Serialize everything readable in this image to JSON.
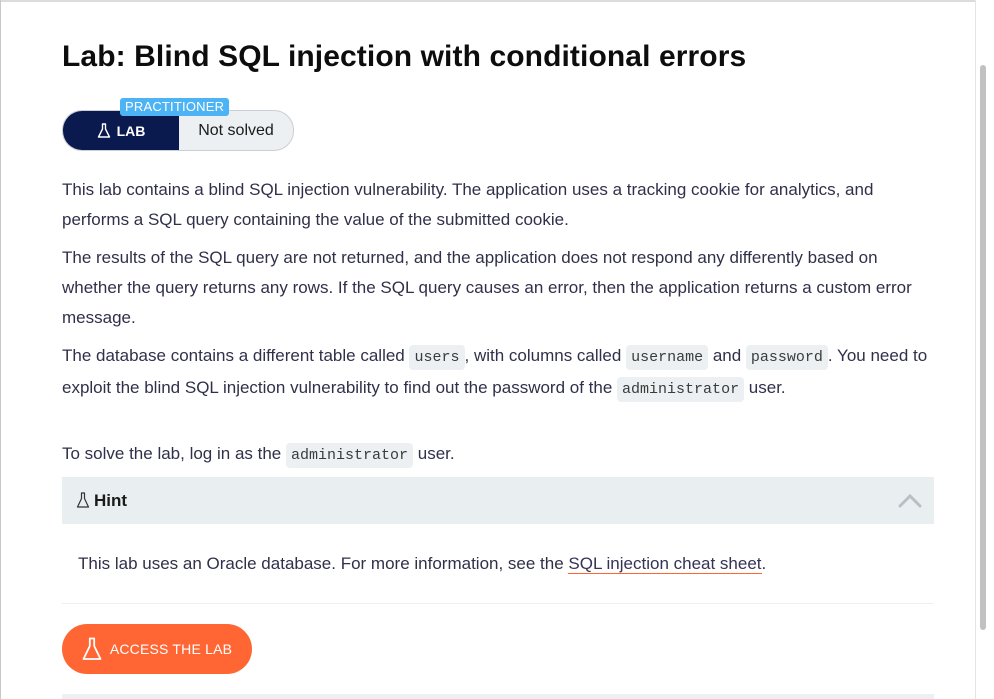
{
  "title": "Lab: Blind SQL injection with conditional errors",
  "badge": {
    "level": "PRACTITIONER",
    "lab_label": "LAB",
    "status": "Not solved"
  },
  "description": {
    "p1": "This lab contains a blind SQL injection vulnerability. The application uses a tracking cookie for analytics, and performs a SQL query containing the value of the submitted cookie.",
    "p2": "The results of the SQL query are not returned, and the application does not respond any differently based on whether the query returns any rows. If the SQL query causes an error, then the application returns a custom error message.",
    "p3": {
      "t1": "The database contains a different table called ",
      "code_users": "users",
      "t2": ", with columns called ",
      "code_username": "username",
      "t3": " and ",
      "code_password": "password",
      "t4": ". You need to exploit the blind SQL injection vulnerability to find out the password of the ",
      "code_admin": "administrator",
      "t5": " user."
    },
    "p4": {
      "t1": "To solve the lab, log in as the ",
      "code_admin": "administrator",
      "t2": " user."
    }
  },
  "hint": {
    "title": "Hint",
    "body_prefix": "This lab uses an Oracle database. For more information, see the ",
    "link_text": "SQL injection cheat sheet",
    "body_suffix": "."
  },
  "access_button": "ACCESS THE LAB",
  "icons": {
    "lab": "flask-icon",
    "hint": "flask-icon",
    "collapse": "chevron-up-icon"
  },
  "colors": {
    "lab_badge_bg": "#0a1a4f",
    "practitioner_bg": "#4cb3f5",
    "accent": "#ff6633",
    "hint_bg": "#e9eef0"
  }
}
